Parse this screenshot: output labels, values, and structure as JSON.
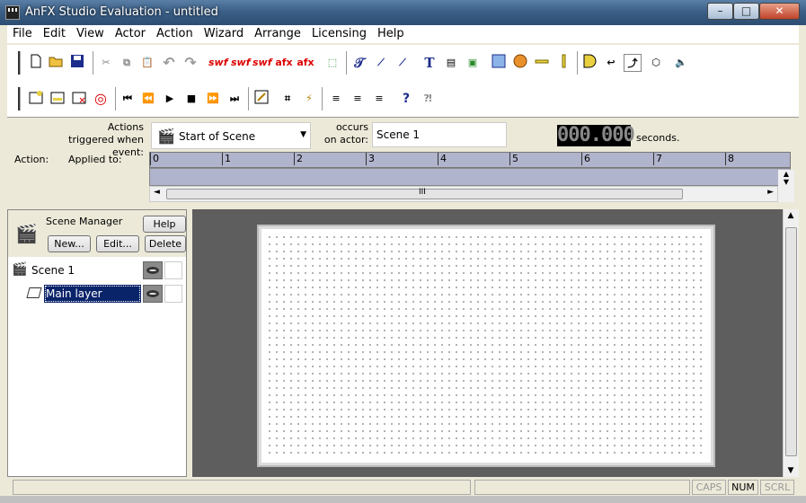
{
  "window": {
    "title": "AnFX Studio Evaluation - untitled",
    "controls": {
      "minimize": "–",
      "maximize": "□",
      "close": "✕"
    }
  },
  "menu": [
    "File",
    "Edit",
    "View",
    "Actor",
    "Action",
    "Wizard",
    "Arrange",
    "Licensing",
    "Help"
  ],
  "toolbar1": {
    "swf1": "swf",
    "swf2": "swf",
    "swf3": "swf",
    "afx1": "afx",
    "afx2": "afx",
    "text_tool": "T"
  },
  "toolbar2": {
    "help_glyph": "?"
  },
  "actions": {
    "triggered_label": "Actions triggered when event:",
    "event_value": "Start of Scene",
    "occurs_label": "occurs on actor:",
    "actor_value": "Scene 1",
    "time_display": "000.000",
    "seconds_label": "seconds.",
    "action_col": "Action:",
    "applied_col": "Applied to:",
    "timeline_ticks": [
      "0",
      "1",
      "2",
      "3",
      "4",
      "5",
      "6",
      "7",
      "8"
    ],
    "scroll_grip": "III"
  },
  "scene_manager": {
    "title": "Scene Manager",
    "help": "Help",
    "new": "New...",
    "edit": "Edit...",
    "delete": "Delete",
    "rows": [
      {
        "label": "Scene 1"
      },
      {
        "label": "Main layer"
      }
    ]
  },
  "status": {
    "caps": "CAPS",
    "num": "NUM",
    "scrl": "SCRL"
  },
  "colors": {
    "accent": "#0a246a",
    "titlebar": "#3b5f86",
    "stage": "#5e5e5e",
    "timeline": "#b0b4cc"
  }
}
